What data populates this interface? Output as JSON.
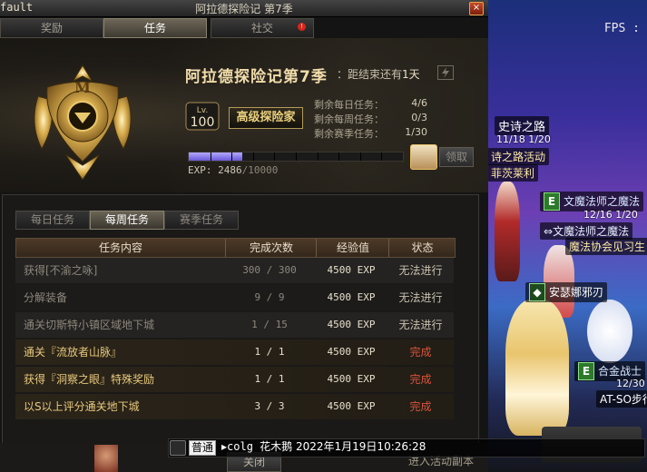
{
  "window": {
    "title_left": "fault",
    "title_center": "阿拉德探险记 第7季"
  },
  "main_tabs": [
    {
      "label": "奖励",
      "active": false
    },
    {
      "label": "任务",
      "active": true
    },
    {
      "label": "社交",
      "active": false,
      "badge": "!"
    }
  ],
  "season": {
    "title": "阿拉德探险记第7季",
    "remaining_prefix": "：距结束还有",
    "remaining_value": "1天",
    "level_label": "Lv.",
    "level": "100",
    "premium_label": "高级探险家",
    "stats": [
      {
        "label": "剩余每日任务：",
        "value": "4/6"
      },
      {
        "label": "剩余每周任务：",
        "value": "0/3"
      },
      {
        "label": "剩余赛季任务：",
        "value": "1/30"
      }
    ],
    "exp_label": "EXP: ",
    "exp_current": "2486",
    "exp_total": "/10000",
    "exp_progress": 0.2486,
    "claim_label": "领取"
  },
  "quest_tabs": [
    {
      "label": "每日任务",
      "active": false
    },
    {
      "label": "每周任务",
      "active": true
    },
    {
      "label": "赛季任务",
      "active": false
    }
  ],
  "table": {
    "headers": [
      "任务内容",
      "完成次数",
      "经验值",
      "状态"
    ],
    "rows": [
      {
        "name": "获得[不渝之咏]",
        "count": "300 / 300",
        "exp": "4500 EXP",
        "status": "无法进行",
        "done": false
      },
      {
        "name": "分解装备",
        "count": "9 / 9",
        "exp": "4500 EXP",
        "status": "无法进行",
        "done": false
      },
      {
        "name": "通关切斯特小镇区域地下城",
        "count": "1 / 15",
        "exp": "4500 EXP",
        "status": "无法进行",
        "done": false
      },
      {
        "name": "通关『流放者山脉』",
        "count": "1 / 1",
        "exp": "4500 EXP",
        "status": "完成",
        "done": true
      },
      {
        "name": "获得『洞察之眼』特殊奖励",
        "count": "1 / 1",
        "exp": "4500 EXP",
        "status": "完成",
        "done": true
      },
      {
        "name": "以S以上评分通关地下城",
        "count": "3 / 3",
        "exp": "4500 EXP",
        "status": "完成",
        "done": true
      }
    ]
  },
  "bottom": {
    "close_label": "关闭",
    "enter_label": "进入活动副本",
    "chat_channel": "普通",
    "chat_name": "colg 花木鹅",
    "chat_time": "2022年1月19日10:26:28"
  },
  "game": {
    "fps": "FPS :",
    "tags": [
      {
        "text": "史诗之路",
        "date": "11/18 1/20"
      },
      {
        "text": "诗之路活动"
      },
      {
        "text": "菲茨莱利"
      },
      {
        "text": "文魔法师之魔法",
        "date": "12/16 1/20"
      },
      {
        "text": "文魔法师之魔法"
      },
      {
        "text": "魔法协会见习生"
      },
      {
        "text": "安瑟娜邪刃"
      },
      {
        "text": "合金战士",
        "date": "12/30"
      },
      {
        "text": "AT-SO步行"
      }
    ]
  },
  "colors": {
    "accent_gold": "#e7c97c",
    "complete_red": "#d8543c",
    "exp_purple": "#8a7af0"
  }
}
